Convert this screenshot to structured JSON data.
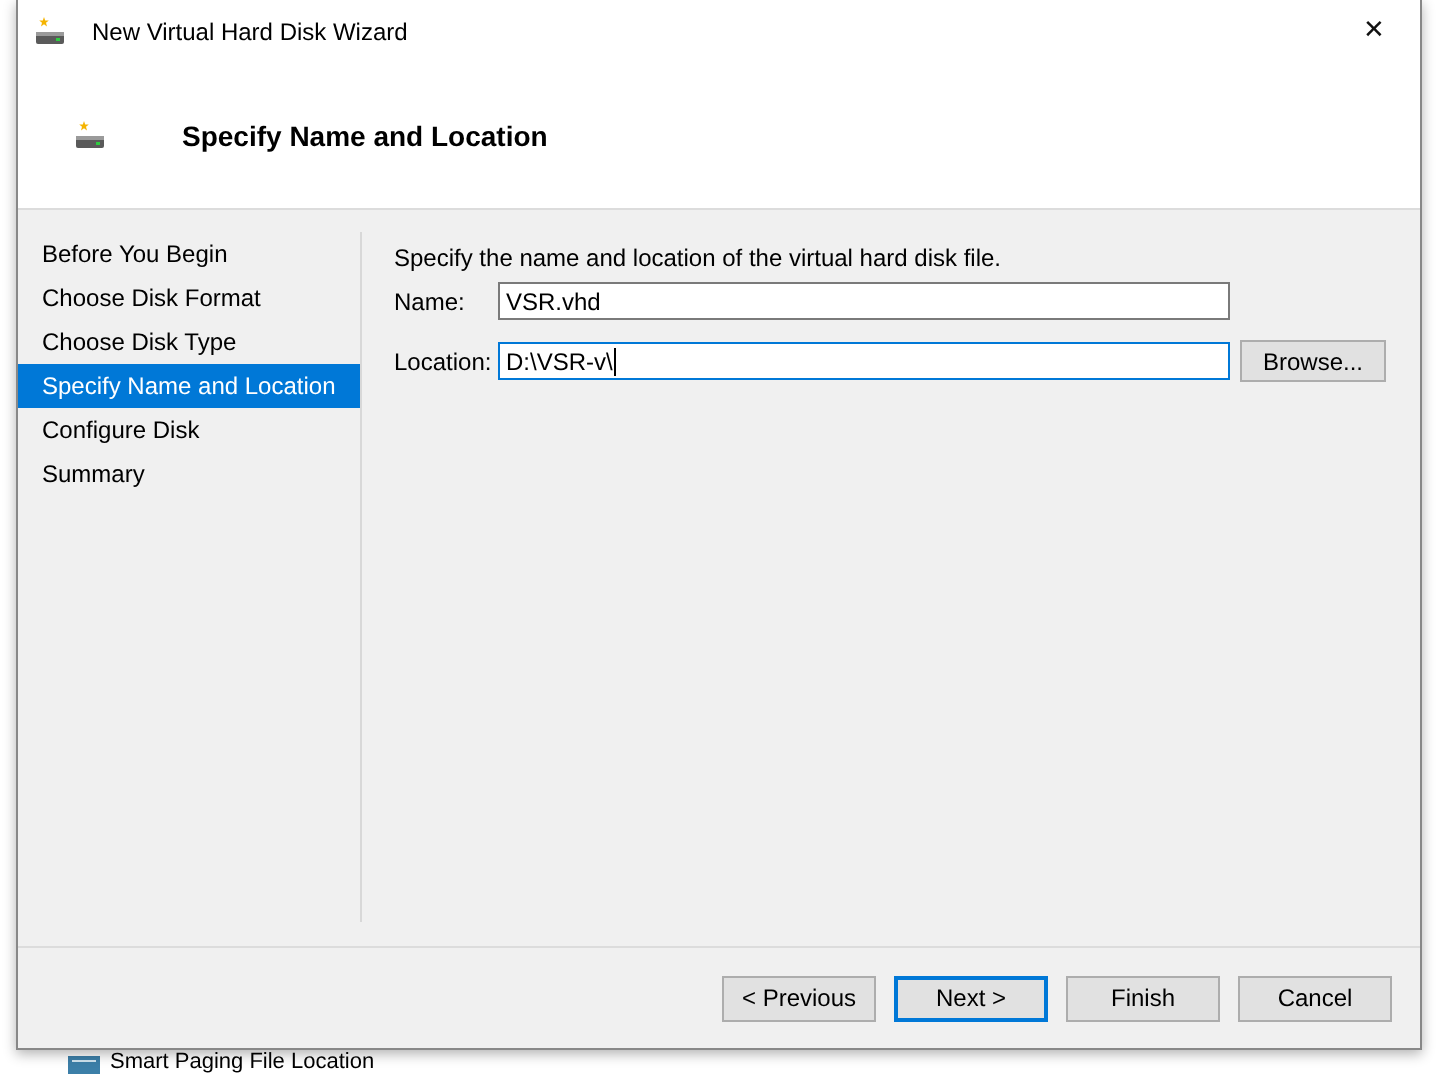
{
  "window": {
    "title": "New Virtual Hard Disk Wizard",
    "close": "✕"
  },
  "header": {
    "title": "Specify Name and Location"
  },
  "steps": [
    {
      "label": "Before You Begin",
      "selected": false
    },
    {
      "label": "Choose Disk Format",
      "selected": false
    },
    {
      "label": "Choose Disk Type",
      "selected": false
    },
    {
      "label": "Specify Name and Location",
      "selected": true
    },
    {
      "label": "Configure Disk",
      "selected": false
    },
    {
      "label": "Summary",
      "selected": false
    }
  ],
  "description": "Specify the name and location of the virtual hard disk file.",
  "fields": [
    {
      "label": "Name:",
      "value": "VSR.vhd",
      "focused": false
    },
    {
      "label": "Location:",
      "value": "D:\\VSR-v\\",
      "focused": true,
      "button": "Browse..."
    }
  ],
  "buttons": [
    {
      "label": "< Previous",
      "default": false
    },
    {
      "label": "Next >",
      "default": true
    },
    {
      "label": "Finish",
      "default": false
    },
    {
      "label": "Cancel",
      "default": false
    }
  ],
  "background_item": {
    "label": "Smart Paging File Location"
  }
}
